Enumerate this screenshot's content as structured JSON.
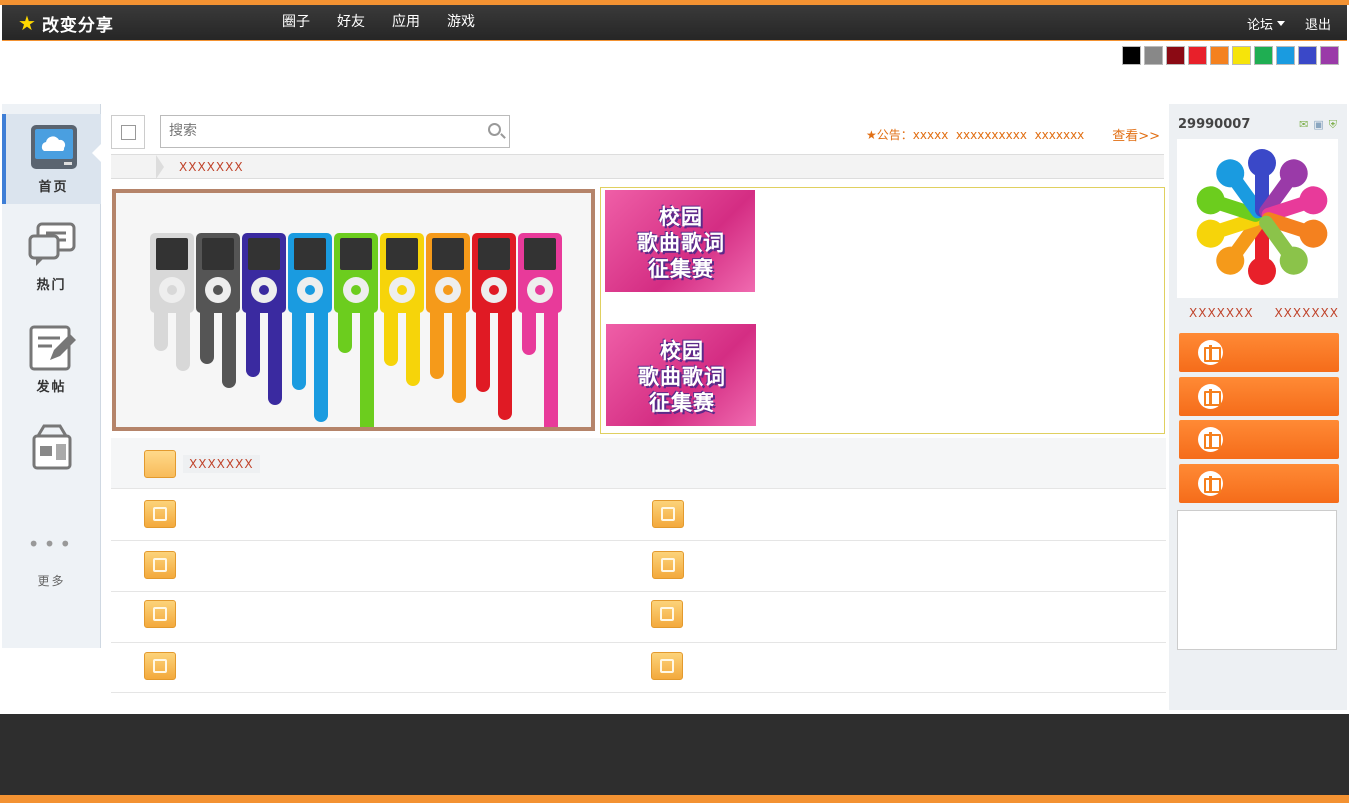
{
  "header": {
    "logo_text": "改变分享",
    "nav": [
      "圈子",
      "好友",
      "应用",
      "游戏"
    ],
    "forum_label": "论坛",
    "logout_label": "退出"
  },
  "theme_colors": [
    "#000000",
    "#888888",
    "#8b0a14",
    "#e8202a",
    "#f4811f",
    "#f6e40a",
    "#1fae52",
    "#1a9be0",
    "#3a48c8",
    "#9a3aa8"
  ],
  "left_nav": [
    {
      "label": "首页",
      "icon": "cloud-monitor-icon"
    },
    {
      "label": "热门",
      "icon": "chat-bubbles-icon"
    },
    {
      "label": "发帖",
      "icon": "edit-note-icon"
    },
    {
      "label": "",
      "icon": "toolbox-icon"
    },
    {
      "label": "更多",
      "icon": "more-dots-icon"
    }
  ],
  "search": {
    "placeholder": "搜索"
  },
  "notice": {
    "prefix": "公告：",
    "items": "xxxxx  xxxxxxxxxx  xxxxxxx",
    "view_more": "查看>>"
  },
  "breadcrumb": {
    "current": "XXXXXXX"
  },
  "promo": {
    "poster_text_line1": "校园",
    "poster_text_line2": "歌曲歌词",
    "poster_text_line3": "征集赛"
  },
  "folder_header": {
    "label": "XXXXXXX"
  },
  "user": {
    "id": "29990007",
    "link_left": "XXXXXXX",
    "link_right": "XXXXXXX",
    "gift_button_count": 4
  }
}
